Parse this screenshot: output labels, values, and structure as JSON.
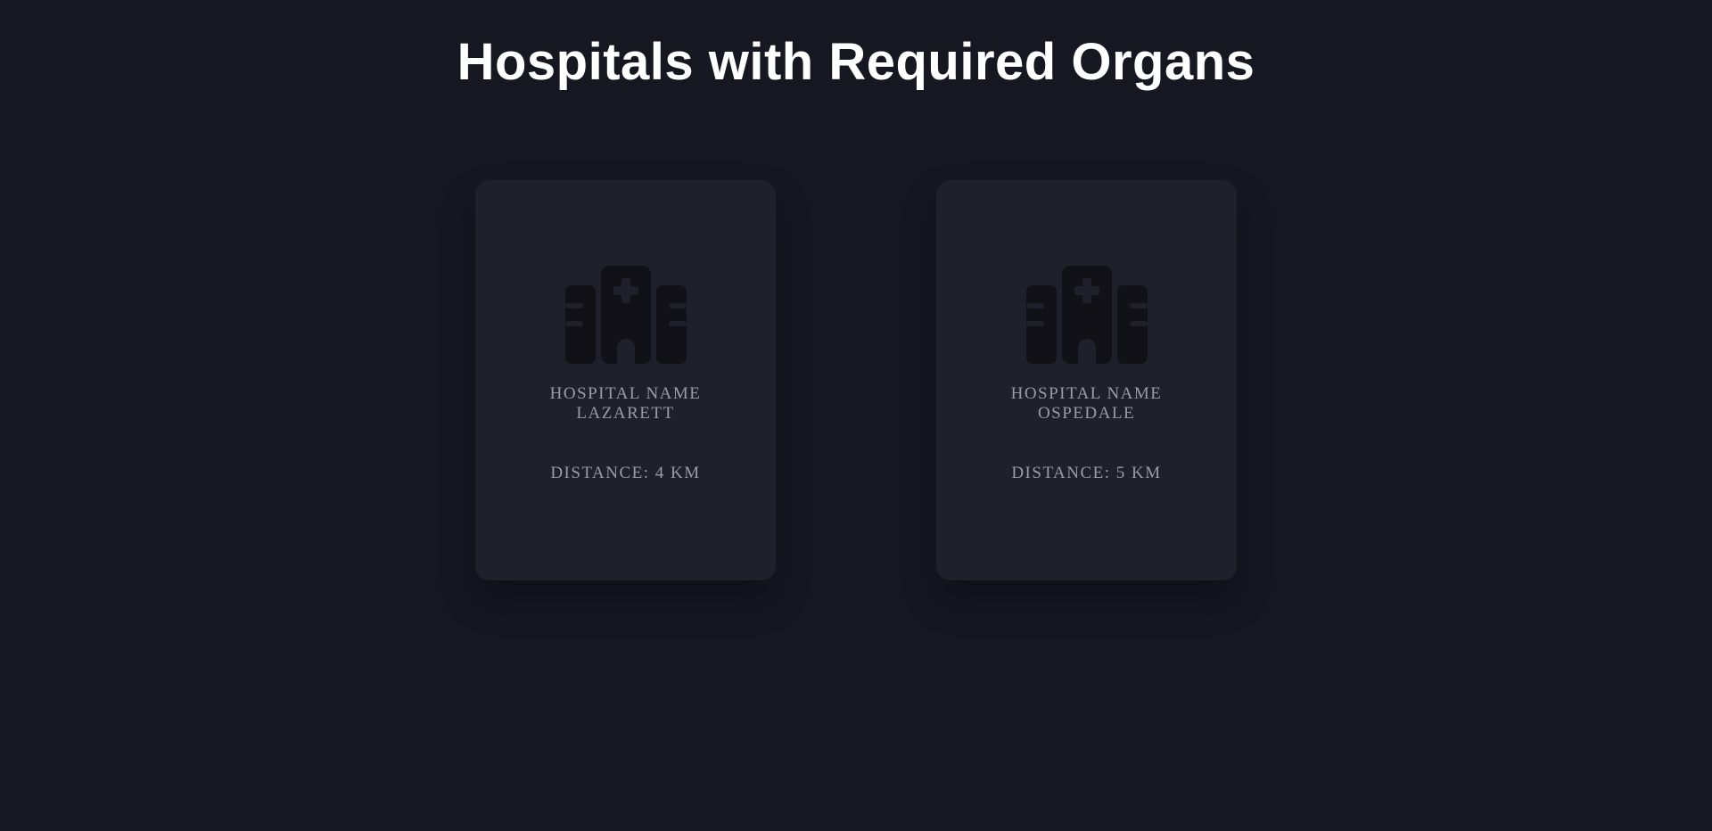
{
  "page": {
    "title": "Hospitals with Required Organs"
  },
  "hospitals": [
    {
      "label": "HOSPITAL NAME",
      "name": "LAZARETT",
      "distance": "DISTANCE: 4 KM",
      "icon": "hospital-icon"
    },
    {
      "label": "HOSPITAL NAME",
      "name": "OSPEDALE",
      "distance": "DISTANCE: 5 KM",
      "icon": "hospital-icon"
    }
  ],
  "colors": {
    "background": "#171722",
    "card": "#20202c",
    "title": "#ffffff",
    "card_text": "#9b9aa6",
    "icon": "#111117"
  }
}
